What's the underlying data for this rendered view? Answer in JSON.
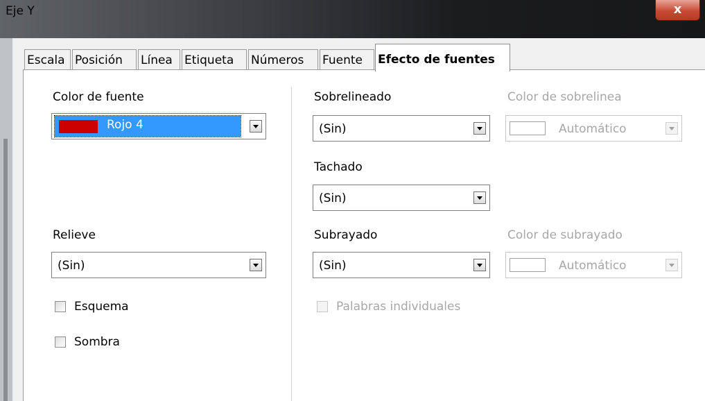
{
  "window": {
    "title": "Eje Y",
    "close_label": "x"
  },
  "tabs": [
    "Escala",
    "Posición",
    "Línea",
    "Etiqueta",
    "Números",
    "Fuente",
    "Efecto de fuentes"
  ],
  "active_tab": "Efecto de fuentes",
  "font_color": {
    "label": "Color de fuente",
    "value": "Rojo 4",
    "swatch_color": "#cc0000"
  },
  "relief": {
    "label": "Relieve",
    "value": "(Sin)"
  },
  "outline": {
    "label": "Esquema",
    "checked": false
  },
  "shadow": {
    "label": "Sombra",
    "checked": false
  },
  "overline": {
    "label": "Sobrelineado",
    "value": "(Sin)"
  },
  "overline_color": {
    "label": "Color de sobrelinea",
    "value": "Automático",
    "enabled": false
  },
  "strikethrough": {
    "label": "Tachado",
    "value": "(Sin)"
  },
  "underline": {
    "label": "Subrayado",
    "value": "(Sin)"
  },
  "underline_color": {
    "label": "Color de subrayado",
    "value": "Automático",
    "enabled": false
  },
  "individual_words": {
    "label": "Palabras individuales",
    "checked": false,
    "enabled": false
  }
}
